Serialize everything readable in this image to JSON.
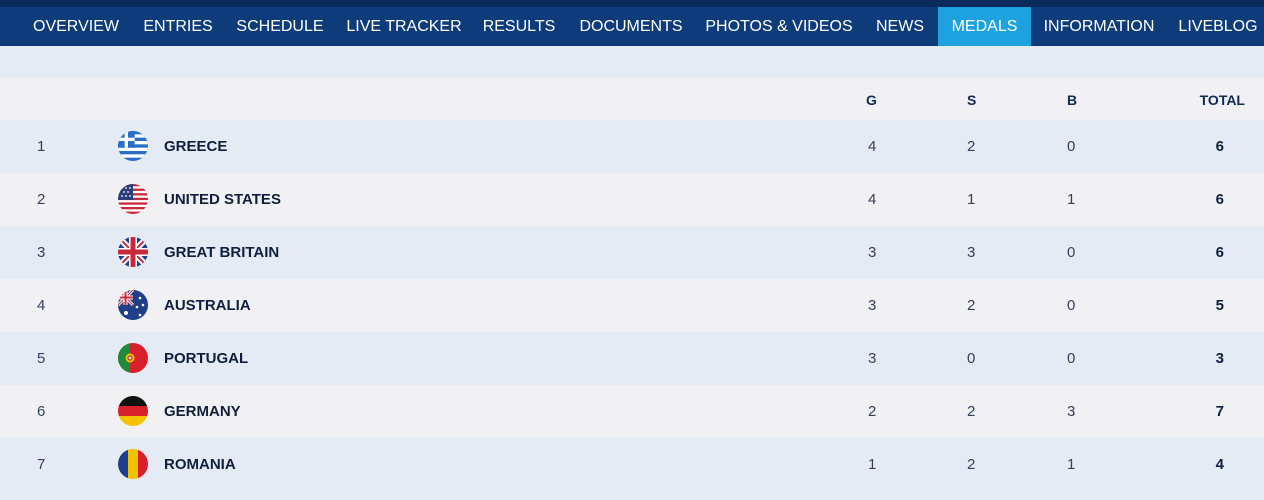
{
  "nav": {
    "items": [
      {
        "label": "OVERVIEW"
      },
      {
        "label": "ENTRIES"
      },
      {
        "label": "SCHEDULE"
      },
      {
        "label": "LIVE TRACKER"
      },
      {
        "label": "RESULTS"
      },
      {
        "label": "DOCUMENTS"
      },
      {
        "label": "PHOTOS & VIDEOS"
      },
      {
        "label": "NEWS"
      },
      {
        "label": "MEDALS"
      },
      {
        "label": "INFORMATION"
      },
      {
        "label": "LIVEBLOG"
      }
    ],
    "active": "MEDALS"
  },
  "table": {
    "headers": {
      "g": "G",
      "s": "S",
      "b": "B",
      "total": "TOTAL"
    },
    "rows": [
      {
        "rank": "1",
        "country": "GREECE",
        "flag": "greece-flag-icon",
        "g": "4",
        "s": "2",
        "b": "0",
        "total": "6"
      },
      {
        "rank": "2",
        "country": "UNITED STATES",
        "flag": "united-states-flag-icon",
        "g": "4",
        "s": "1",
        "b": "1",
        "total": "6"
      },
      {
        "rank": "3",
        "country": "GREAT BRITAIN",
        "flag": "great-britain-flag-icon",
        "g": "3",
        "s": "3",
        "b": "0",
        "total": "6"
      },
      {
        "rank": "4",
        "country": "AUSTRALIA",
        "flag": "australia-flag-icon",
        "g": "3",
        "s": "2",
        "b": "0",
        "total": "5"
      },
      {
        "rank": "5",
        "country": "PORTUGAL",
        "flag": "portugal-flag-icon",
        "g": "3",
        "s": "0",
        "b": "0",
        "total": "3"
      },
      {
        "rank": "6",
        "country": "GERMANY",
        "flag": "germany-flag-icon",
        "g": "2",
        "s": "2",
        "b": "3",
        "total": "7"
      },
      {
        "rank": "7",
        "country": "ROMANIA",
        "flag": "romania-flag-icon",
        "g": "1",
        "s": "2",
        "b": "1",
        "total": "4"
      }
    ]
  },
  "colors": {
    "nav_bg": "#0e3b7a",
    "nav_active": "#1ea1e0",
    "row_odd": "#e4ebf4",
    "row_even": "#f1f1f3",
    "heading_text": "#0f2a55"
  }
}
